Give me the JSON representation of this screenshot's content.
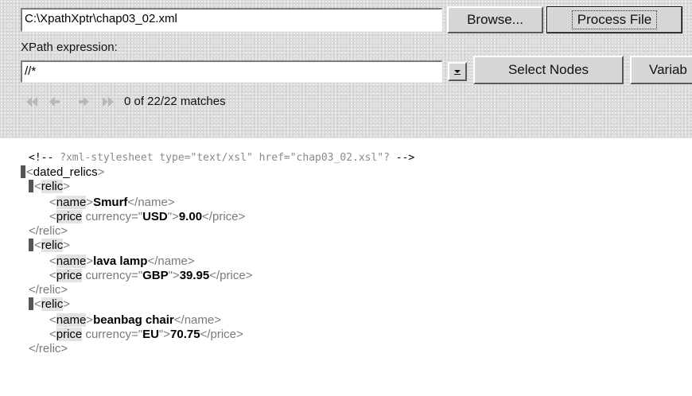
{
  "file": {
    "path": "C:\\XpathXptr\\chap03_02.xml"
  },
  "buttons": {
    "browse": "Browse...",
    "process": "Process File",
    "select": "Select Nodes",
    "variables": "Variab"
  },
  "xpath": {
    "label": "XPath expression:",
    "value": "//*"
  },
  "nav": {
    "status": "0 of 22/22 matches"
  },
  "xml": {
    "comment_open": "<!--",
    "comment_text": " ?xml-stylesheet type=\"text/xsl\" href=\"chap03_02.xsl\"? ",
    "comment_close": "-->",
    "root_open": "dated_relics",
    "relic_tag": "relic",
    "relic_close": "</relic>",
    "name_tag": "name",
    "price_tag": "price",
    "attr_name": "currency",
    "relics": [
      {
        "name": "Smurf",
        "currency": "USD",
        "price": "9.00"
      },
      {
        "name": "lava lamp",
        "currency": "GBP",
        "price": "39.95"
      },
      {
        "name": "beanbag chair",
        "currency": "EU",
        "price": "70.75"
      }
    ]
  },
  "colors": {
    "toolbar_bg": "#dcdcdc",
    "highlight": "#e2e2e2",
    "markup": "#7a7a7a"
  },
  "icons": [
    "first-icon",
    "previous-icon",
    "next-icon",
    "last-icon",
    "dropdown-arrow-icon"
  ]
}
